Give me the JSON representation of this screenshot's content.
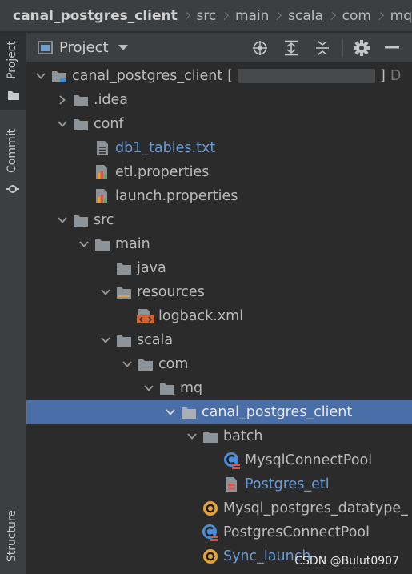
{
  "breadcrumb": {
    "items": [
      "canal_postgres_client",
      "src",
      "main",
      "scala",
      "com",
      "mq"
    ]
  },
  "sidebar": {
    "tabs": {
      "project": "Project",
      "commit": "Commit",
      "structure": "Structure"
    }
  },
  "panel": {
    "title": "Project",
    "actions": [
      "locate-icon",
      "expand-all-icon",
      "collapse-all-icon",
      "gear-icon",
      "minimize-icon"
    ]
  },
  "tree": {
    "root_label": "canal_postgres_client",
    "root_bracket_open": "[",
    "root_bracket_close": "]",
    "root_suffix": "D",
    "idea": ".idea",
    "conf": "conf",
    "db1_tables": "db1_tables.txt",
    "etl_properties": "etl.properties",
    "launch_properties": "launch.properties",
    "src": "src",
    "main": "main",
    "java": "java",
    "resources": "resources",
    "logback": "logback.xml",
    "scala": "scala",
    "com": "com",
    "mq": "mq",
    "pkg": "canal_postgres_client",
    "batch": "batch",
    "mysql_pool": "MysqlConnectPool",
    "postgres_etl": "Postgres_etl",
    "datatype": "Mysql_postgres_datatype_",
    "pg_pool": "PostgresConnectPool",
    "sync_launch": "Sync_launch"
  },
  "colors": {
    "selection": "#4a6fa8",
    "vcs_changed": "#6b9bd6",
    "folder": "#8c9499",
    "scala_red": "#d9534f",
    "object_orange": "#e3a23b"
  },
  "watermark": "CSDN @Bulut0907"
}
